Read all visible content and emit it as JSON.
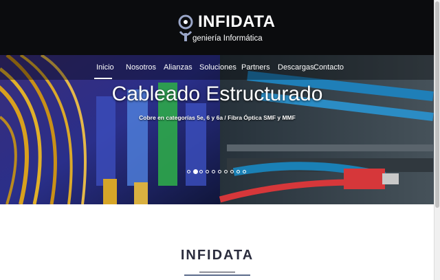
{
  "brand": {
    "title": "INFIDATA",
    "subtitle": "geniería Informática"
  },
  "nav": {
    "items": [
      {
        "label": "Inicio",
        "active": true
      },
      {
        "label": "Nosotros"
      },
      {
        "label": "Alianzas"
      },
      {
        "label": "Soluciones"
      },
      {
        "label": "Partners"
      },
      {
        "label": "Descargas"
      },
      {
        "label": "Contacto"
      }
    ]
  },
  "hero": {
    "title": "Cableado Estructurado",
    "subtitle": "Cobre en categorías 5e, 6 y 6a / Fibra Óptica SMF y MMF",
    "slide_count": 10,
    "active_slide": 2
  },
  "section": {
    "title": "INFIDATA"
  },
  "colors": {
    "topbar": "#0b0c0e",
    "accent": "#5a6a8a",
    "heading": "#2b2d3e"
  }
}
